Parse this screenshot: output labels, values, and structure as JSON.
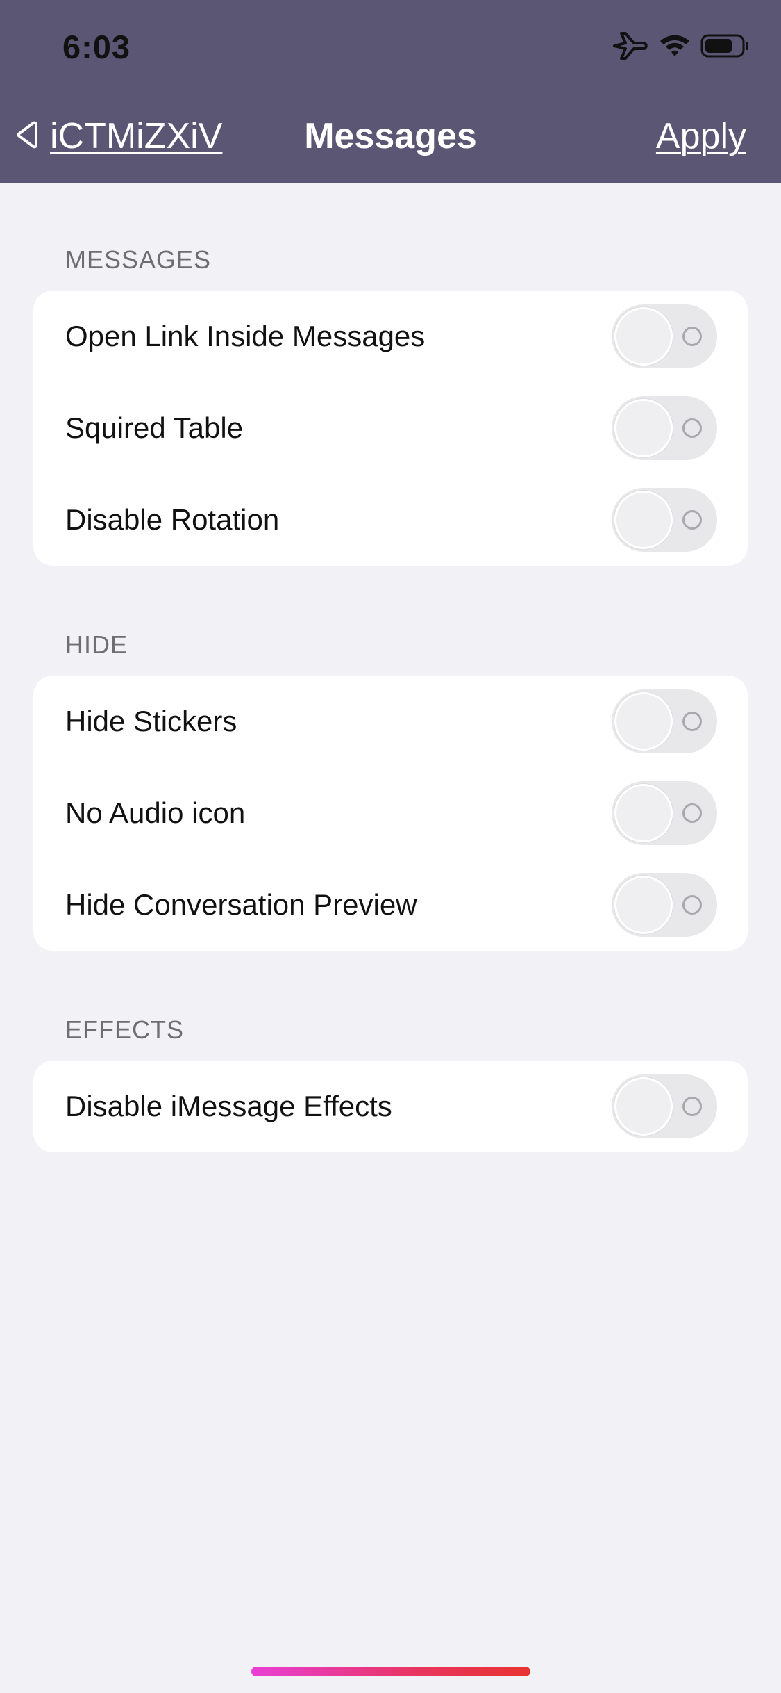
{
  "status_bar": {
    "time": "6:03",
    "icons": [
      "airplane-icon",
      "wifi-icon",
      "battery-icon"
    ]
  },
  "nav": {
    "back_label": "iCTMiZXiV",
    "title": "Messages",
    "apply_label": "Apply"
  },
  "colors": {
    "header_bg": "#5a5674",
    "page_bg": "#f2f1f6",
    "toggle_off": "#e8e8ea"
  },
  "sections": [
    {
      "header": "MESSAGES",
      "items": [
        {
          "label": "Open Link Inside Messages",
          "on": false
        },
        {
          "label": "Squired Table",
          "on": false
        },
        {
          "label": "Disable Rotation",
          "on": false
        }
      ]
    },
    {
      "header": "HIDE",
      "items": [
        {
          "label": "Hide Stickers",
          "on": false
        },
        {
          "label": "No Audio icon",
          "on": false
        },
        {
          "label": "Hide Conversation Preview",
          "on": false
        }
      ]
    },
    {
      "header": "EFFECTS",
      "items": [
        {
          "label": "Disable iMessage Effects",
          "on": false
        }
      ]
    }
  ]
}
